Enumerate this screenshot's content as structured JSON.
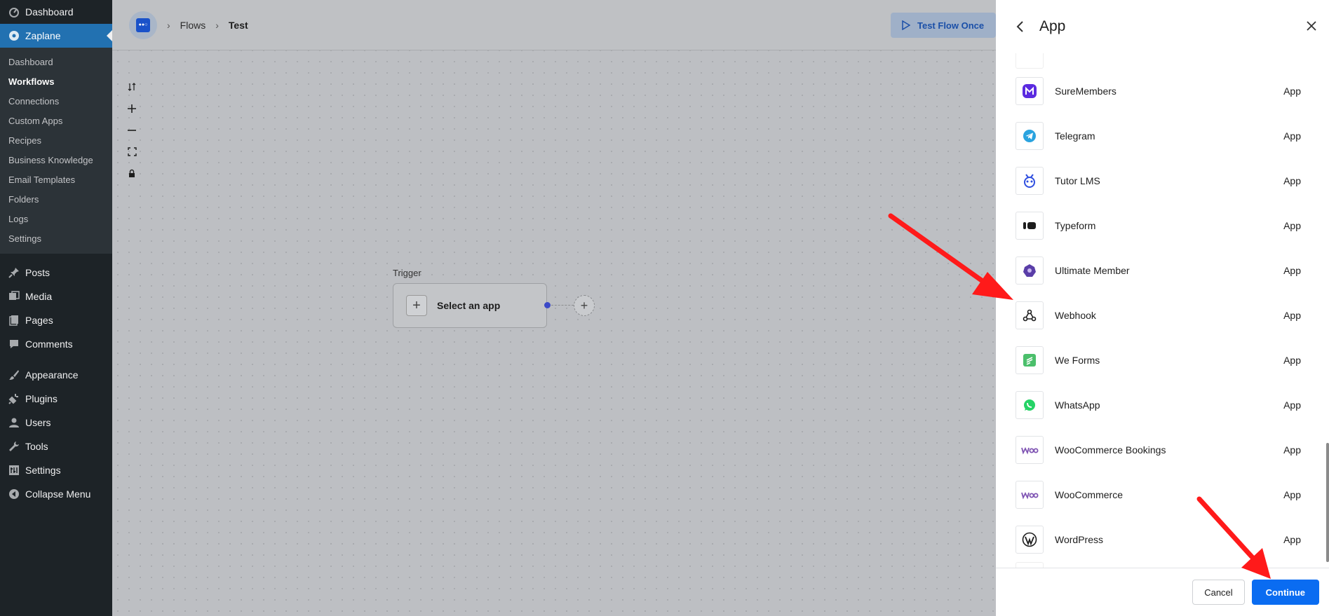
{
  "wp_sidebar": {
    "top_items": [
      {
        "label": "Dashboard",
        "icon": "dashboard-icon"
      },
      {
        "label": "Zaplane",
        "icon": "zaplane-icon"
      }
    ],
    "submenu": [
      "Dashboard",
      "Workflows",
      "Connections",
      "Custom Apps",
      "Recipes",
      "Business Knowledge",
      "Email Templates",
      "Folders",
      "Logs",
      "Settings"
    ],
    "current_submenu": "Workflows",
    "items": [
      {
        "label": "Posts",
        "icon": "pin-icon"
      },
      {
        "label": "Media",
        "icon": "media-icon"
      },
      {
        "label": "Pages",
        "icon": "pages-icon"
      },
      {
        "label": "Comments",
        "icon": "comment-icon"
      }
    ],
    "items2": [
      {
        "label": "Appearance",
        "icon": "brush-icon"
      },
      {
        "label": "Plugins",
        "icon": "plug-icon"
      },
      {
        "label": "Users",
        "icon": "user-icon"
      },
      {
        "label": "Tools",
        "icon": "wrench-icon"
      },
      {
        "label": "Settings",
        "icon": "settings-icon"
      },
      {
        "label": "Collapse Menu",
        "icon": "collapse-icon"
      }
    ]
  },
  "topbar": {
    "breadcrumbs": [
      "Flows",
      "Test"
    ],
    "test_button": "Test Flow Once"
  },
  "canvas": {
    "trigger_label": "Trigger",
    "trigger_node_text": "Select an app"
  },
  "panel": {
    "title": "App",
    "apps": [
      {
        "name": "SureMembers",
        "type": "App",
        "icon": "suremembers-icon",
        "color": "#5b2be0"
      },
      {
        "name": "Telegram",
        "type": "App",
        "icon": "telegram-icon",
        "color": "#2aa3df"
      },
      {
        "name": "Tutor LMS",
        "type": "App",
        "icon": "tutor-lms-icon",
        "color": "#2f4fe0"
      },
      {
        "name": "Typeform",
        "type": "App",
        "icon": "typeform-icon",
        "color": "#1d1d1d"
      },
      {
        "name": "Ultimate Member",
        "type": "App",
        "icon": "ultimate-member-icon",
        "color": "#5a3ea8"
      },
      {
        "name": "Webhook",
        "type": "App",
        "icon": "webhook-icon",
        "color": "#1d1d1d"
      },
      {
        "name": "We Forms",
        "type": "App",
        "icon": "we-forms-icon",
        "color": "#4bbf6b"
      },
      {
        "name": "WhatsApp",
        "type": "App",
        "icon": "whatsapp-icon",
        "color": "#25d366"
      },
      {
        "name": "WooCommerce Bookings",
        "type": "App",
        "icon": "woo-icon",
        "color": "#7f54b3"
      },
      {
        "name": "WooCommerce",
        "type": "App",
        "icon": "woo-icon",
        "color": "#7f54b3"
      },
      {
        "name": "WordPress",
        "type": "App",
        "icon": "wordpress-icon",
        "color": "#1d1d1d"
      }
    ],
    "cancel_label": "Cancel",
    "continue_label": "Continue"
  },
  "colors": {
    "wp_sidebar_bg": "#1d2327",
    "wp_active": "#2271b1",
    "primary_button": "#0a6cf1",
    "annotation_arrow": "#ff1a1a"
  }
}
